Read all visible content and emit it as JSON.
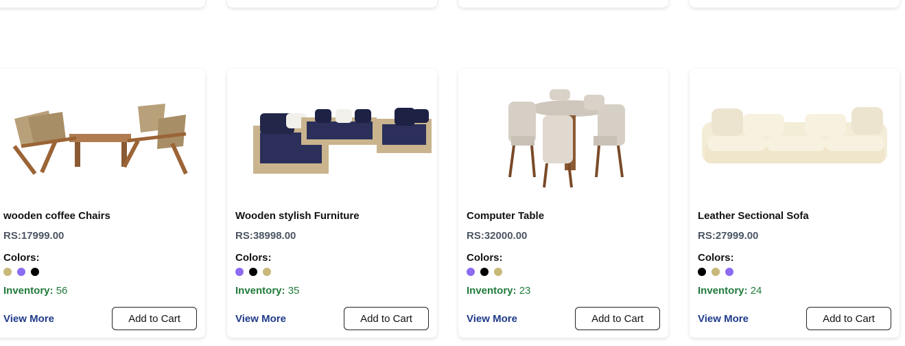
{
  "products": [
    {
      "title": "wooden coffee Chairs",
      "price": "RS:17999.00",
      "colors_label": "Colors:",
      "colors": [
        "#c8b87a",
        "#8b6cf2",
        "#000000"
      ],
      "inventory_label": "Inventory:",
      "inventory_value": "56",
      "view_more": "View More",
      "add_to_cart": "Add to Cart",
      "image_icon": "wooden-chairs-image"
    },
    {
      "title": "Wooden stylish Furniture",
      "price": "RS:38998.00",
      "colors_label": "Colors:",
      "colors": [
        "#8b6cf2",
        "#000000",
        "#c8b87a"
      ],
      "inventory_label": "Inventory:",
      "inventory_value": "35",
      "view_more": "View More",
      "add_to_cart": "Add to Cart",
      "image_icon": "sofa-set-image"
    },
    {
      "title": "Computer Table",
      "price": "RS:32000.00",
      "colors_label": "Colors:",
      "colors": [
        "#8b6cf2",
        "#000000",
        "#c8b87a"
      ],
      "inventory_label": "Inventory:",
      "inventory_value": "23",
      "view_more": "View More",
      "add_to_cart": "Add to Cart",
      "image_icon": "dining-table-image"
    },
    {
      "title": "Leather Sectional Sofa",
      "price": "RS:27999.00",
      "colors_label": "Colors:",
      "colors": [
        "#000000",
        "#c8b87a",
        "#8b6cf2"
      ],
      "inventory_label": "Inventory:",
      "inventory_value": "24",
      "view_more": "View More",
      "add_to_cart": "Add to Cart",
      "image_icon": "sofa-image"
    }
  ]
}
